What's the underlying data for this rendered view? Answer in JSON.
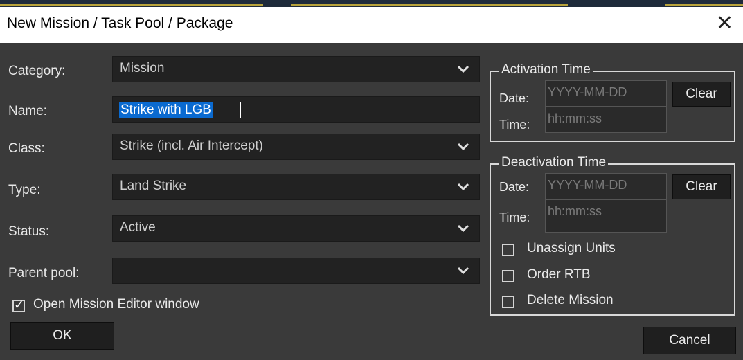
{
  "window": {
    "title": "New Mission / Task Pool / Package",
    "close_glyph": "✕"
  },
  "fields": {
    "category": {
      "label": "Category:",
      "value": "Mission"
    },
    "name": {
      "label": "Name:",
      "value": "Strike with LGB"
    },
    "class": {
      "label": "Class:",
      "value": "Strike (incl. Air Intercept)"
    },
    "type": {
      "label": "Type:",
      "value": "Land Strike"
    },
    "status": {
      "label": "Status:",
      "value": "Active"
    },
    "parent_pool": {
      "label": "Parent pool:",
      "value": ""
    }
  },
  "open_editor": {
    "label": "Open Mission Editor window",
    "checked": true
  },
  "activation": {
    "title": "Activation Time",
    "date_label": "Date:",
    "date_placeholder": "YYYY-MM-DD",
    "time_label": "Time:",
    "time_placeholder": "hh:mm:ss",
    "clear_label": "Clear"
  },
  "deactivation": {
    "title": "Deactivation Time",
    "date_label": "Date:",
    "date_placeholder": "YYYY-MM-DD",
    "time_label": "Time:",
    "time_placeholder": "hh:mm:ss",
    "clear_label": "Clear",
    "options": [
      {
        "label": "Unassign Units",
        "checked": false
      },
      {
        "label": "Order RTB",
        "checked": false
      },
      {
        "label": "Delete Mission",
        "checked": false
      }
    ]
  },
  "buttons": {
    "ok": "OK",
    "cancel": "Cancel"
  },
  "colors": {
    "dialog_bg": "#3a3a3a",
    "field_bg": "#222222",
    "selection": "#0a6ad0"
  },
  "icons": {
    "dropdown": "chevron-down-icon",
    "check": "checkmark-icon",
    "close": "close-icon"
  }
}
